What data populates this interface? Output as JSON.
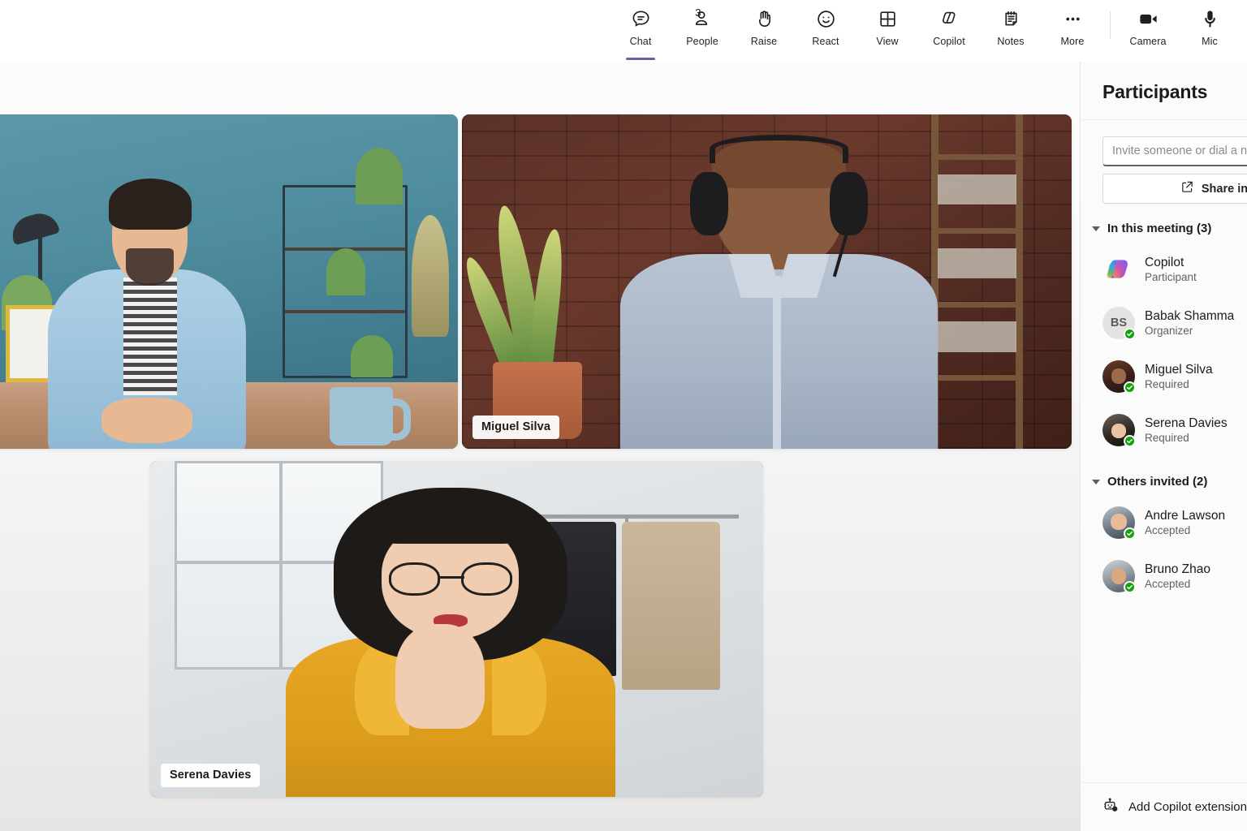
{
  "toolbar": {
    "items": [
      {
        "label": "Chat",
        "icon": "chat-icon",
        "active": true,
        "badge": ""
      },
      {
        "label": "People",
        "icon": "people-icon",
        "active": false,
        "badge": "3"
      },
      {
        "label": "Raise",
        "icon": "raise-hand-icon",
        "active": false,
        "badge": ""
      },
      {
        "label": "React",
        "icon": "react-smiley-icon",
        "active": false,
        "badge": ""
      },
      {
        "label": "View",
        "icon": "view-grid-icon",
        "active": false,
        "badge": ""
      },
      {
        "label": "Copilot",
        "icon": "copilot-icon",
        "active": false,
        "badge": ""
      },
      {
        "label": "Notes",
        "icon": "notes-icon",
        "active": false,
        "badge": ""
      },
      {
        "label": "More",
        "icon": "more-ellipsis-icon",
        "active": false,
        "badge": ""
      }
    ],
    "media": [
      {
        "label": "Camera",
        "icon": "camera-icon"
      },
      {
        "label": "Mic",
        "icon": "microphone-icon"
      }
    ],
    "active_accent": "#6264a7"
  },
  "stage": {
    "tiles": [
      {
        "name": "",
        "show_name": false
      },
      {
        "name": "Miguel Silva",
        "show_name": true
      },
      {
        "name": "Serena Davies",
        "show_name": true
      }
    ]
  },
  "panel": {
    "title": "Participants",
    "invite_placeholder": "Invite someone or dial a number",
    "invite_value": "",
    "share_label": "Share invite",
    "share_icon": "share-icon",
    "groups": [
      {
        "label": "In this meeting (3)",
        "expanded": true,
        "people": [
          {
            "name": "Copilot",
            "role": "Participant",
            "avatar": "copilot-logo",
            "presence": false
          },
          {
            "name": "Babak Shamma",
            "role": "Organizer",
            "avatar": "initials",
            "initials": "BS",
            "presence": true
          },
          {
            "name": "Miguel Silva",
            "role": "Required",
            "avatar": "photo-miguel",
            "presence": true
          },
          {
            "name": "Serena Davies",
            "role": "Required",
            "avatar": "photo-serena",
            "presence": true
          }
        ]
      },
      {
        "label": "Others invited (2)",
        "expanded": true,
        "people": [
          {
            "name": "Andre Lawson",
            "role": "Accepted",
            "avatar": "photo-andre",
            "presence": true
          },
          {
            "name": "Bruno Zhao",
            "role": "Accepted",
            "avatar": "photo-bruno",
            "presence": true
          }
        ]
      }
    ],
    "footer": {
      "label": "Add Copilot extensions",
      "icon": "robot-icon"
    },
    "presence_color": "#13a10e"
  }
}
